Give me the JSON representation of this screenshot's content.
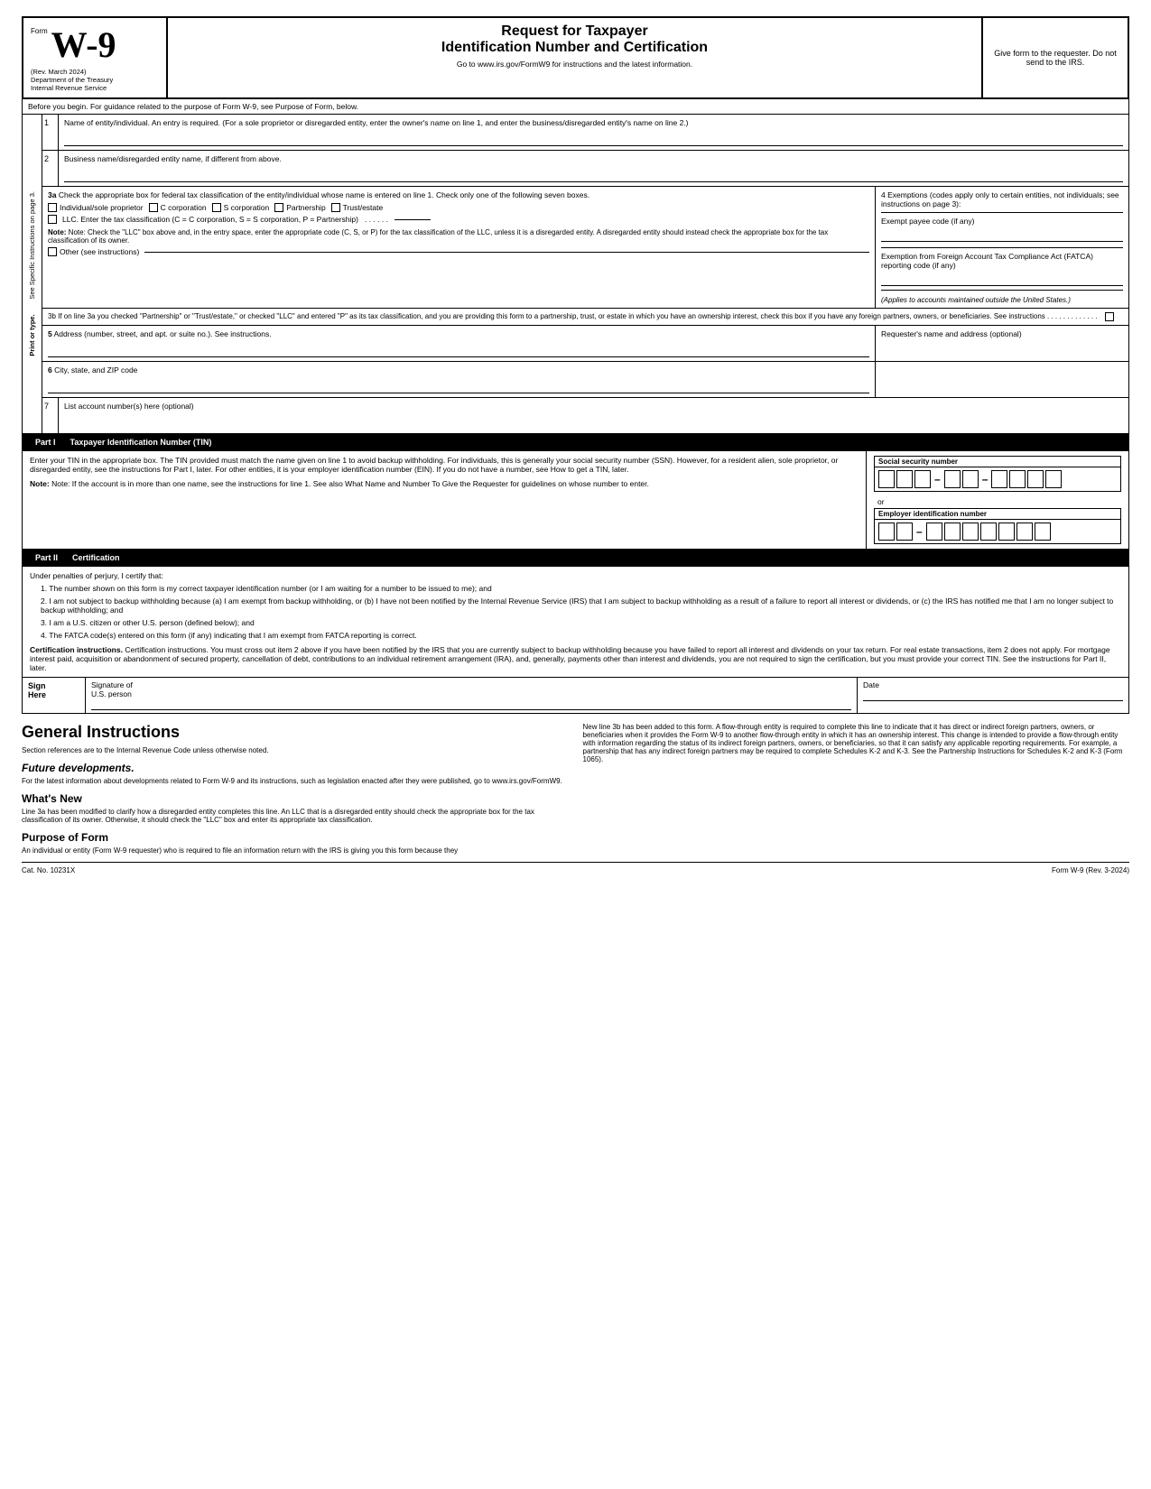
{
  "header": {
    "form_label": "Form",
    "w9_big": "W-9",
    "rev": "(Rev. March 2024)",
    "dept1": "Department of the Treasury",
    "dept2": "Internal Revenue Service",
    "title1": "Request for Taxpayer",
    "title2": "Identification Number and Certification",
    "url_text": "Go to www.irs.gov/FormW9 for instructions and the latest information.",
    "give_form": "Give form to the requester. Do not send to the IRS."
  },
  "before_begin": {
    "text": "Before you begin. For guidance related to the purpose of Form W-9, see Purpose of Form, below."
  },
  "field1": {
    "number": "1",
    "label": "Name of entity/individual. An entry is required. (For a sole proprietor or disregarded entity, enter the owner's name on line 1, and enter the business/disregarded entity's name on line 2.)"
  },
  "field2": {
    "number": "2",
    "label": "Business name/disregarded entity name, if different from above."
  },
  "field3a": {
    "number": "3a",
    "label": "Check the appropriate box for federal tax classification of the entity/individual whose name is entered on line 1. Check only one of the following seven boxes.",
    "checkboxes": [
      "Individual/sole proprietor",
      "C corporation",
      "S corporation",
      "Partnership",
      "Trust/estate"
    ],
    "llc_label": "LLC. Enter the tax classification (C = C corporation, S = S corporation, P = Partnership)",
    "note_text": "Note: Check the \"LLC\" box above and, in the entry space, enter the appropriate code (C, S, or P) for the tax classification of the LLC, unless it is a disregarded entity. A disregarded entity should instead check the appropriate box for the tax classification of its owner.",
    "other_label": "Other (see instructions)"
  },
  "field4": {
    "label": "4 Exemptions (codes apply only to certain entities, not individuals; see instructions on page 3):",
    "exempt_payee": "Exempt payee code (if any)",
    "fatca_label": "Exemption from Foreign Account Tax Compliance Act (FATCA) reporting code (if any)",
    "applies_text": "(Applies to accounts maintained outside the United States.)"
  },
  "field3b": {
    "text": "3b If on line 3a you checked \"Partnership\" or \"Trust/estate,\" or checked \"LLC\" and entered \"P\" as its tax classification, and you are providing this form to a partnership, trust, or estate in which you have an ownership interest, check this box if you have any foreign partners, owners, or beneficiaries. See instructions . . . . . . . . . . . . ."
  },
  "field5": {
    "number": "5",
    "label": "Address (number, street, and apt. or suite no.). See instructions.",
    "requester_label": "Requester's name and address (optional)"
  },
  "field6": {
    "number": "6",
    "label": "City, state, and ZIP code"
  },
  "field7": {
    "number": "7",
    "label": "List account number(s) here (optional)"
  },
  "sidebar": {
    "line1": "See Specific Instructions on page 3.",
    "line2": "Print or type."
  },
  "part1": {
    "label": "Part I",
    "title": "Taxpayer Identification Number (TIN)",
    "intro": "Enter your TIN in the appropriate box. The TIN provided must match the name given on line 1 to avoid backup withholding. For individuals, this is generally your social security number (SSN). However, for a resident alien, sole proprietor, or disregarded entity, see the instructions for Part I, later. For other entities, it is your employer identification number (EIN). If you do not have a number, see How to get a TIN, later.",
    "note": "Note: If the account is in more than one name, see the instructions for line 1. See also What Name and Number To Give the Requester for guidelines on whose number to enter.",
    "ssn_label": "Social security number",
    "or_text": "or",
    "ein_label": "Employer identification number",
    "ssn_cells_count": 9,
    "ein_cells_count": 9
  },
  "part2": {
    "label": "Part II",
    "title": "Certification",
    "intro": "Under penalties of perjury, I certify that:",
    "items": [
      "1. The number shown on this form is my correct taxpayer identification number (or I am waiting for a number to be issued to me); and",
      "2. I am not subject to backup withholding because (a) I am exempt from backup withholding, or (b) I have not been notified by the Internal Revenue Service (IRS) that I am subject to backup withholding as a result of a failure to report all interest or dividends, or (c) the IRS has notified me that I am no longer subject to backup withholding; and",
      "3. I am a U.S. citizen or other U.S. person (defined below); and",
      "4. The FATCA code(s) entered on this form (if any) indicating that I am exempt from FATCA reporting is correct."
    ],
    "cert_instructions": "Certification instructions. You must cross out item 2 above if you have been notified by the IRS that you are currently subject to backup withholding because you have failed to report all interest and dividends on your tax return. For real estate transactions, item 2 does not apply. For mortgage interest paid, acquisition or abandonment of secured property, cancellation of debt, contributions to an individual retirement arrangement (IRA), and, generally, payments other than interest and dividends, you are not required to sign the certification, but you must provide your correct TIN. See the instructions for Part II, later."
  },
  "sign": {
    "label": "Sign\nHere",
    "sig_label": "Signature of",
    "sig_sub": "U.S. person",
    "date_label": "Date"
  },
  "general": {
    "title": "General Instructions",
    "section_ref": "Section references are to the Internal Revenue Code unless otherwise noted.",
    "future_title": "Future developments.",
    "future_text": "For the latest information about developments related to Form W-9 and its instructions, such as legislation enacted after they were published, go to www.irs.gov/FormW9.",
    "whats_new_title": "What's New",
    "whats_new_text": "Line 3a has been modified to clarify how a disregarded entity completes this line. An LLC that is a disregarded entity should check the appropriate box for the tax classification of its owner. Otherwise, it should check the \"LLC\" box and enter its appropriate tax classification.",
    "purpose_title": "Purpose of Form",
    "purpose_text": "An individual or entity (Form W-9 requester) who is required to file an information return with the IRS is giving you this form because they"
  },
  "right_col": {
    "new_line_text": "New line 3b has been added to this form. A flow-through entity is required to complete this line to indicate that it has direct or indirect foreign partners, owners, or beneficiaries when it provides the Form W-9 to another flow-through entity in which it has an ownership interest. This change is intended to provide a flow-through entity with information regarding the status of its indirect foreign partners, owners, or beneficiaries, so that it can satisfy any applicable reporting requirements. For example, a partnership that has any indirect foreign partners may be required to complete Schedules K-2 and K-3. See the Partnership Instructions for Schedules K-2 and K-3 (Form 1065)."
  },
  "footer": {
    "cat_no": "Cat. No. 10231X",
    "form_label": "Form W-9 (Rev. 3-2024)"
  }
}
